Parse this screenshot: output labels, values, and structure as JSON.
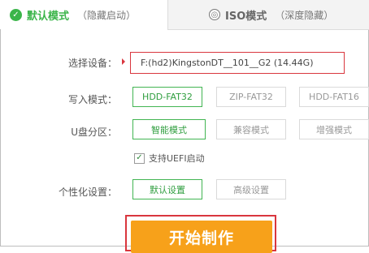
{
  "tabs": {
    "default": {
      "icon": "check-icon",
      "glyph": "✓",
      "label": "默认模式",
      "sub": "（隐藏启动）"
    },
    "iso": {
      "icon": "disc-icon",
      "glyph": "◎",
      "label": "ISO模式",
      "sub": "（深度隐藏）"
    }
  },
  "device": {
    "label": "选择设备：",
    "value": "F:(hd2)KingstonDT__101__G2 (14.44G)"
  },
  "write_mode": {
    "label": "写入模式：",
    "options": [
      "HDD-FAT32",
      "ZIP-FAT32",
      "HDD-FAT16"
    ],
    "selected": "HDD-FAT32"
  },
  "partition": {
    "label": "U盘分区：",
    "options": [
      "智能模式",
      "兼容模式",
      "增强模式"
    ],
    "selected": "智能模式"
  },
  "uefi": {
    "label": "支持UEFI启动",
    "checked": true,
    "glyph": "✓"
  },
  "personalize": {
    "label": "个性化设置：",
    "options": [
      "默认设置",
      "高级设置"
    ],
    "selected": "默认设置"
  },
  "start_button": {
    "label": "开始制作"
  },
  "colors": {
    "accent": "#3bb54a",
    "highlight": "#d9363e",
    "start": "#f7a11a"
  }
}
